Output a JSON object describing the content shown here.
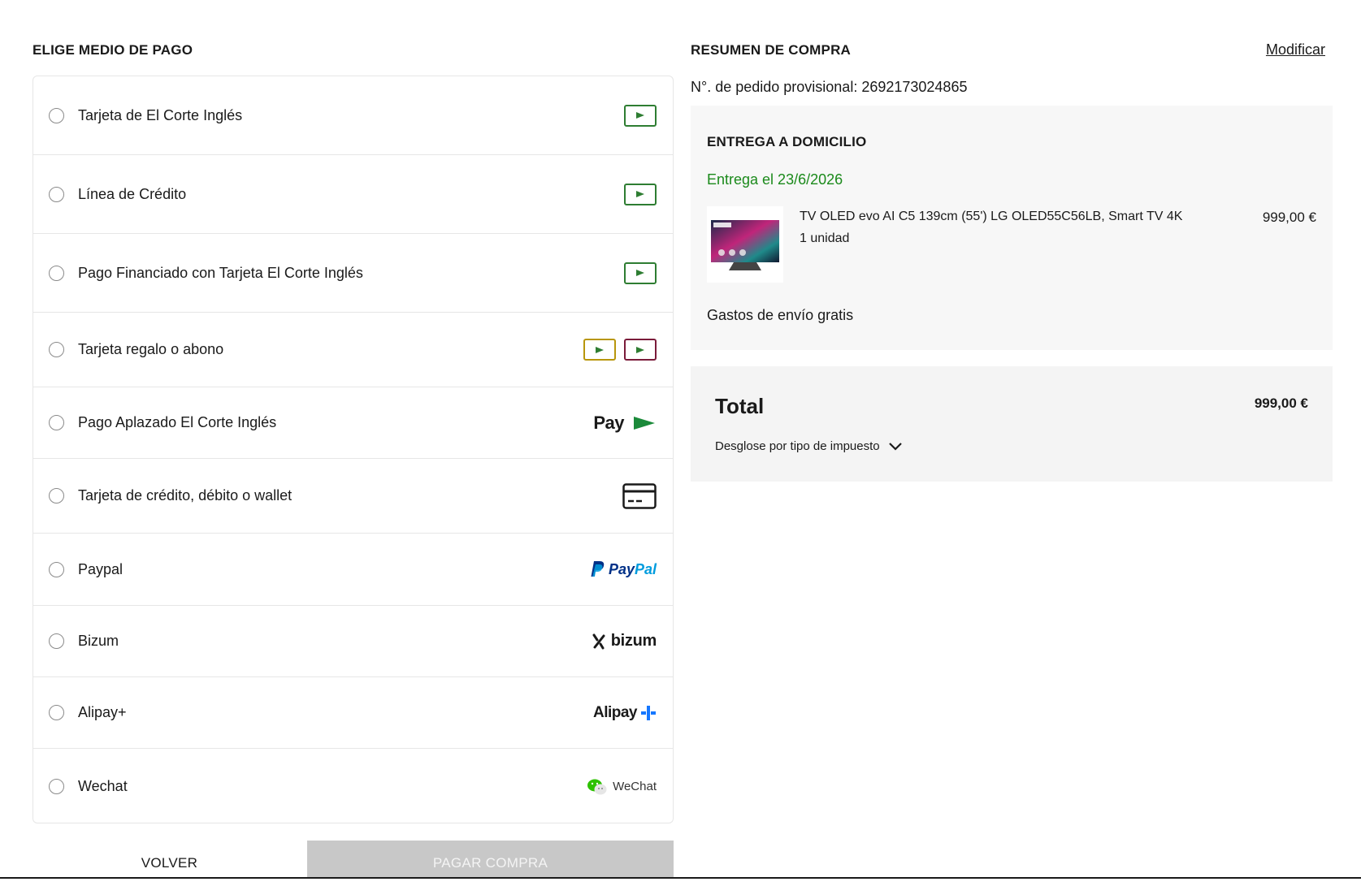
{
  "payment": {
    "title": "ELIGE MEDIO DE PAGO",
    "methods": [
      {
        "label": "Tarjeta de El Corte Inglés",
        "icon": "eci-card-icon"
      },
      {
        "label": "Línea de Crédito",
        "icon": "eci-card-icon"
      },
      {
        "label": "Pago Financiado con Tarjeta El Corte Inglés",
        "icon": "eci-card-icon"
      },
      {
        "label": "Tarjeta regalo o abono",
        "icon": "gift-card-icons"
      },
      {
        "label": "Pago Aplazado El Corte Inglés",
        "icon": "eci-pay-logo",
        "logo_text": "Pay"
      },
      {
        "label": "Tarjeta de crédito, débito o wallet",
        "icon": "credit-card-icon"
      },
      {
        "label": "Paypal",
        "icon": "paypal-logo",
        "logo_text_1": "Pay",
        "logo_text_2": "Pal"
      },
      {
        "label": "Bizum",
        "icon": "bizum-logo",
        "logo_text": "bizum"
      },
      {
        "label": "Alipay+",
        "icon": "alipay-logo",
        "logo_text": "Alipay"
      },
      {
        "label": "Wechat",
        "icon": "wechat-logo",
        "logo_text": "WeChat"
      }
    ],
    "back_label": "VOLVER",
    "pay_label": "PAGAR COMPRA"
  },
  "summary": {
    "title": "RESUMEN DE COMPRA",
    "modify_label": "Modificar",
    "order_number": "N°. de pedido provisional: 2692173024865",
    "delivery": {
      "title": "ENTREGA A DOMICILIO",
      "date": "Entrega el 23/6/2026",
      "product": {
        "name": "TV OLED evo AI C5 139cm (55') LG OLED55C56LB, Smart TV 4K",
        "quantity": "1 unidad",
        "price": "999,00 €"
      },
      "shipping": "Gastos de envío gratis"
    },
    "total": {
      "label": "Total",
      "amount": "999,00 €",
      "tax_breakdown": "Desglose por tipo de impuesto"
    }
  },
  "colors": {
    "accent_green": "#1b8a1b",
    "card_green": "#2e7d32",
    "card_gold": "#b8960c",
    "card_maroon": "#7a1b3a",
    "disabled_button": "#c8c8c8"
  }
}
